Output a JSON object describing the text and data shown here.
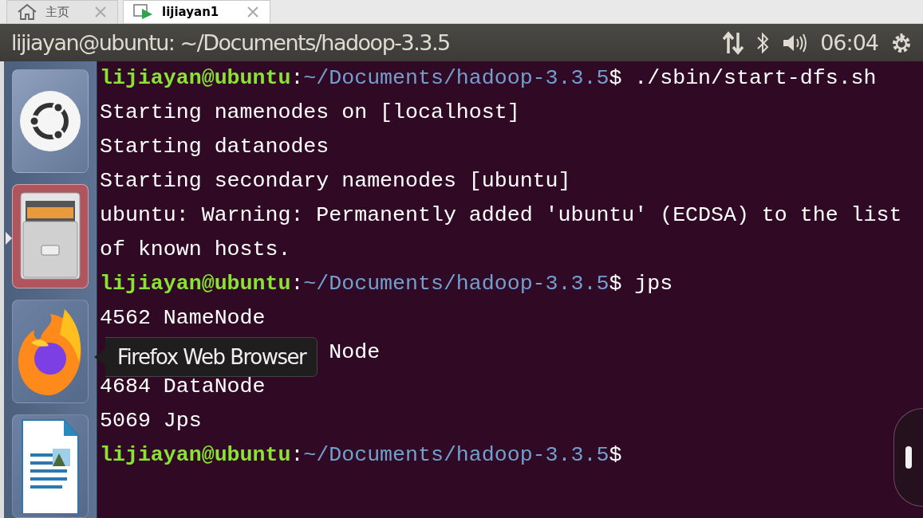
{
  "tabs": [
    {
      "label": "主页",
      "kind": "home",
      "selected": false
    },
    {
      "label": "lijiayan1",
      "kind": "vm",
      "selected": true
    }
  ],
  "panel": {
    "title": "lijiayan@ubuntu: ~/Documents/hadoop-3.3.5",
    "time": "06:04"
  },
  "launcher": [
    {
      "kind": "dash",
      "running": false
    },
    {
      "kind": "files",
      "running": true
    },
    {
      "kind": "browser",
      "running": false
    },
    {
      "kind": "document",
      "running": false
    }
  ],
  "tooltip": {
    "text": "Firefox Web Browser"
  },
  "terminal": {
    "lines": [
      {
        "kind": "prompt",
        "user": "lijiayan@ubuntu",
        "separator": ":",
        "path": "~/Documents/hadoop-3.3.5",
        "symbol": "$",
        "command": "./sbin/start-dfs.sh"
      },
      {
        "kind": "output",
        "text": "Starting namenodes on [localhost]"
      },
      {
        "kind": "output",
        "text": "Starting datanodes"
      },
      {
        "kind": "output",
        "text": "Starting secondary namenodes [ubuntu]"
      },
      {
        "kind": "output",
        "text": "ubuntu: Warning: Permanently added 'ubuntu' (ECDSA) to the list"
      },
      {
        "kind": "output",
        "text": "of known hosts."
      },
      {
        "kind": "prompt",
        "user": "lijiayan@ubuntu",
        "separator": ":",
        "path": "~/Documents/hadoop-3.3.5",
        "symbol": "$",
        "command": "jps"
      },
      {
        "kind": "output",
        "text": "4562 NameNode"
      },
      {
        "kind": "covered",
        "text": "Node"
      },
      {
        "kind": "output",
        "text": "4684 DataNode"
      },
      {
        "kind": "output",
        "text": "5069 Jps"
      },
      {
        "kind": "prompt",
        "user": "lijiayan@ubuntu",
        "separator": ":",
        "path": "~/Documents/hadoop-3.3.5",
        "symbol": "$"
      }
    ]
  }
}
